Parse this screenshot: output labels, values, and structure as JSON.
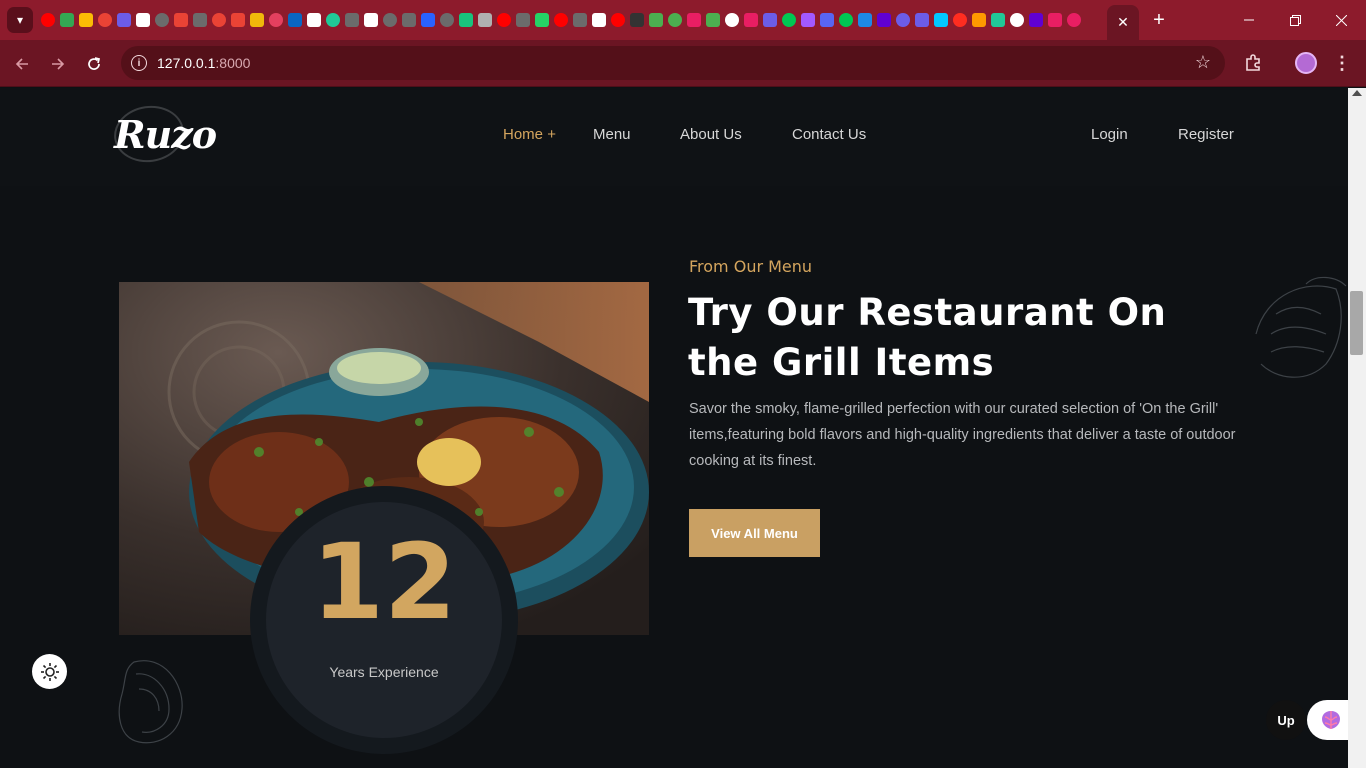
{
  "browser": {
    "address": {
      "host": "127.0.0.1",
      "port": ":8000"
    },
    "active_tab_close": "✕",
    "new_tab": "+",
    "pinned_tab_colors": [
      "#ff0000",
      "#34a853",
      "#fbbc05",
      "#ea4335",
      "#6c5ce7",
      "#ffffff",
      "#6b6b6b",
      "#ea4335",
      "#6b6b6b",
      "#ea4335",
      "#ea4335",
      "#f0b90b",
      "#e4405f",
      "#0a66c2",
      "#ffffff",
      "#20c997",
      "#6b6b6b",
      "#ffffff",
      "#6b6b6b",
      "#6b6b6b",
      "#2962ff",
      "#6b6b6b",
      "#19c37d",
      "#b0b0b0",
      "#ff0000",
      "#6b6b6b",
      "#25d366",
      "#ff0000",
      "#6b6b6b",
      "#ffffff",
      "#ff0000",
      "#333333",
      "#4caf50",
      "#4caf50",
      "#e91e63",
      "#4caf50",
      "#ffffff",
      "#e91e63",
      "#6c5ce7",
      "#00c853",
      "#a259ff",
      "#5865f2",
      "#00c853",
      "#1e88e5",
      "#6001d2",
      "#6c5ce7",
      "#6c5ce7",
      "#00c8ff",
      "#ff2d20",
      "#ff9900",
      "#20c997",
      "#ffffff",
      "#6001d2",
      "#e91e63",
      "#e91e63"
    ]
  },
  "site": {
    "logo": "Ruzo",
    "nav": [
      {
        "label": "Home",
        "suffix": "+"
      },
      {
        "label": "Menu"
      },
      {
        "label": "About Us"
      },
      {
        "label": "Contact Us"
      }
    ],
    "auth": {
      "login": "Login",
      "register": "Register"
    }
  },
  "hero": {
    "kicker": "From Our Menu",
    "headline": "Try Our Restaurant On the Grill Items",
    "description": "Savor the smoky, flame-grilled perfection with our curated selection of 'On the Grill' items,featuring bold flavors and high-quality ingredients that deliver a taste of outdoor cooking at its finest.",
    "cta": "View All Menu",
    "experience_number": "12",
    "experience_label": "Years Experience"
  },
  "widgets": {
    "upwork_label": "Up"
  },
  "colors": {
    "accent": "#d4a55e",
    "button": "#c9a063",
    "background": "#0e1114",
    "browser_frame": "#8d1b2c"
  }
}
